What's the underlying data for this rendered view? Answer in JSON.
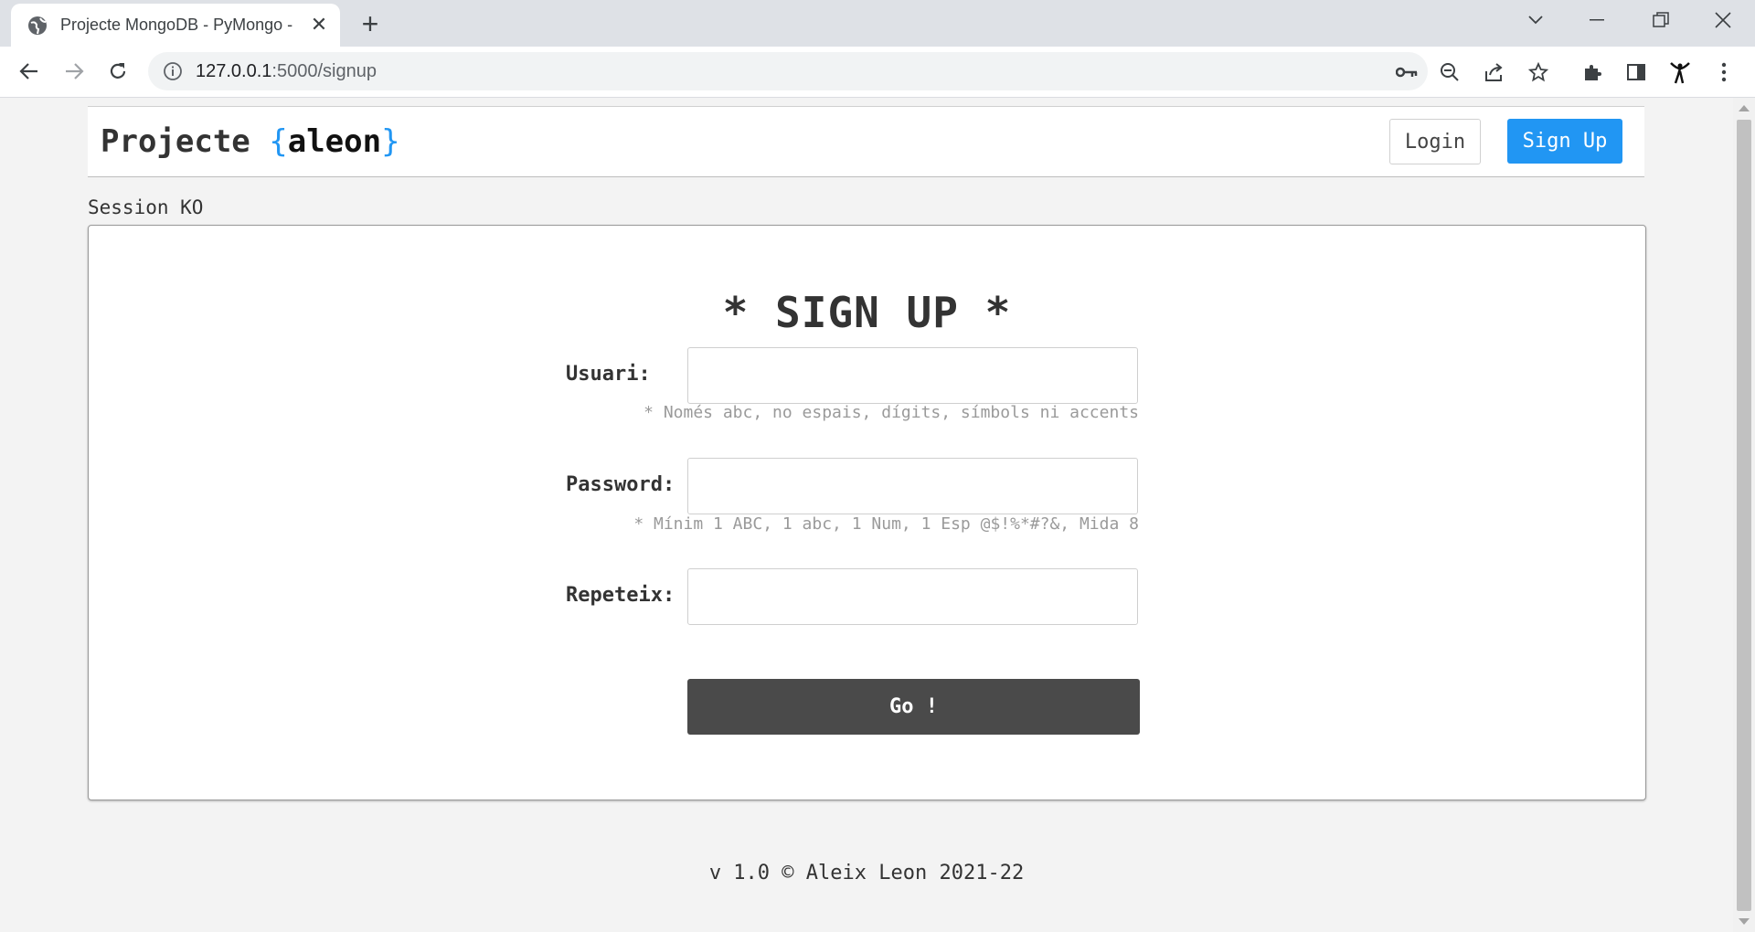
{
  "browser": {
    "tab_title": "Projecte MongoDB - PyMongo -",
    "tab_close": "✕",
    "new_tab": "+",
    "url_host": "127.0.0.1",
    "url_path": ":5000/signup"
  },
  "header": {
    "brand_prefix": "Projecte ",
    "brand_open": "{",
    "brand_name": "aleon",
    "brand_close": "}",
    "login_label": "Login",
    "signup_label": "Sign Up",
    "accent_color": "#2196f3"
  },
  "session_status": "Session KO",
  "form": {
    "title": "* SIGN UP *",
    "username_label": "Usuari:",
    "username_hint": "* Només abc, no espais, dígits, símbols ni accents",
    "password_label": "Password:",
    "password_hint": "* Mínim 1 ABC, 1 abc, 1 Num, 1 Esp @$!%*#?&, Mida 8",
    "repeat_label": "Repeteix:",
    "submit_label": "Go !"
  },
  "footer": {
    "text": "v 1.0 © Aleix Leon 2021-22"
  }
}
